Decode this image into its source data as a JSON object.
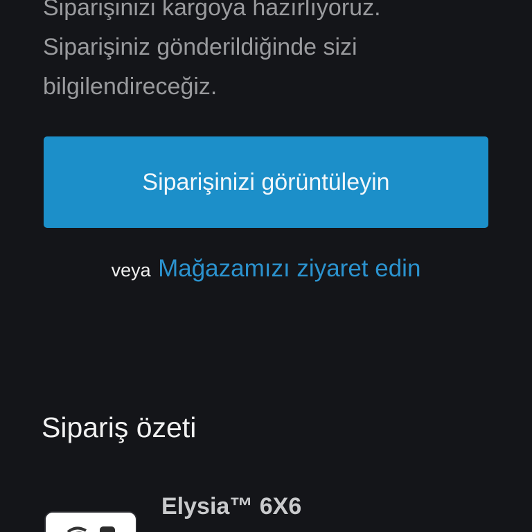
{
  "confirmation": {
    "lines": [
      "Siparişinizi kargoya hazırlıyoruz.",
      "Siparişiniz gönderildiğinde sizi",
      "bilgilendireceğiz."
    ]
  },
  "primary_action": {
    "label": "Siparişinizi görüntüleyin"
  },
  "secondary_action": {
    "prefix": "veya",
    "link_label": "Mağazamızı ziyaret edin"
  },
  "order_summary": {
    "title": "Sipariş özeti",
    "items": [
      {
        "name": "Elysia™ 6X6"
      }
    ]
  },
  "colors": {
    "background": "#141519",
    "accent": "#1c8fc9",
    "link": "#2b93cf"
  }
}
